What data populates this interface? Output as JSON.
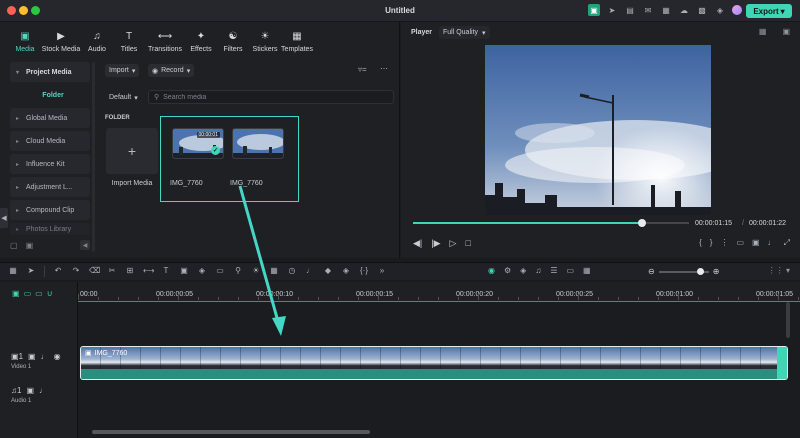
{
  "window": {
    "title": "Untitled",
    "export_label": "Export"
  },
  "tabs": [
    {
      "label": "Media",
      "icon": "media-icon"
    },
    {
      "label": "Stock Media",
      "icon": "stock-media-icon"
    },
    {
      "label": "Audio",
      "icon": "music-note-icon"
    },
    {
      "label": "Titles",
      "icon": "text-icon"
    },
    {
      "label": "Transitions",
      "icon": "transitions-icon"
    },
    {
      "label": "Effects",
      "icon": "effects-icon"
    },
    {
      "label": "Filters",
      "icon": "filters-icon"
    },
    {
      "label": "Stickers",
      "icon": "stickers-icon"
    },
    {
      "label": "Templates",
      "icon": "templates-icon"
    }
  ],
  "sidebar": {
    "items": [
      {
        "label": "Project Media"
      },
      {
        "label": "Folder"
      },
      {
        "label": "Global Media"
      },
      {
        "label": "Cloud Media"
      },
      {
        "label": "Influence Kit"
      },
      {
        "label": "Adjustment L..."
      },
      {
        "label": "Compound Clip"
      },
      {
        "label": "Photos Library"
      }
    ]
  },
  "browser": {
    "import_label": "Import",
    "record_label": "Record",
    "default_label": "Default",
    "search_placeholder": "Search media",
    "folder_heading": "FOLDER",
    "import_media_label": "Import Media",
    "clips": [
      {
        "name": "IMG_7760",
        "duration": "00:00:01",
        "selected": true
      },
      {
        "name": "IMG_7760",
        "selected": false
      }
    ]
  },
  "player": {
    "title": "Player",
    "quality": "Full Quality",
    "current_time": "00:00:01:15",
    "total_time": "00:00:01:22",
    "separator": "/",
    "progress": 0.83
  },
  "timeline": {
    "ruler_labels": [
      "00:00",
      "00:00:00:05",
      "00:00:00:10",
      "00:00:00:15",
      "00:00:00:20",
      "00:00:00:25",
      "00:00:01:00",
      "00:00:01:05"
    ],
    "video_track": {
      "label": "Video 1",
      "number": "1",
      "clip_name": "IMG_7760"
    },
    "audio_track": {
      "label": "Audio 1",
      "number": "1"
    },
    "zoom_level": 0.82
  },
  "colors": {
    "accent": "#3fd6b5",
    "playhead_red": "#d94a4a"
  }
}
